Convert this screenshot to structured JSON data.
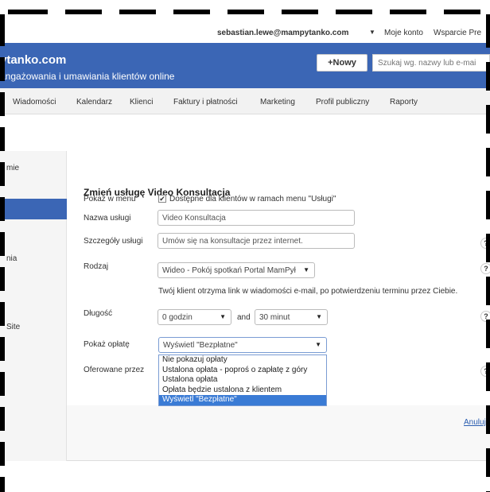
{
  "userbar": {
    "email": "sebastian.lewe@mampytanko.com",
    "account": "Moje konto",
    "help": "Wsparcie Pre"
  },
  "header": {
    "brand": "ytanko.com",
    "tagline": "angażowania i umawiania klientów online",
    "new_button": "+Nowy",
    "search_placeholder": "Szukaj wg. nazwy lub e-mai"
  },
  "nav": {
    "items": [
      "Wiadomości",
      "Kalendarz",
      "Klienci",
      "Faktury i płatności",
      "Marketing",
      "Profil publiczny",
      "Raporty"
    ]
  },
  "sidebar": {
    "items": [
      "mie",
      "nia",
      "Site"
    ]
  },
  "form": {
    "title": "Zmień usługę Video Konsultacja",
    "show_in_menu_label": "Pokaż w menu",
    "show_in_menu_check": "✔",
    "show_in_menu_text": "Dostępne dla klientów w ramach menu \"Usługi\"",
    "name_label": "Nazwa usługi",
    "name_value": "Video Konsultacja",
    "details_label": "Szczegóły usługi",
    "details_value": "Umów się na konsultacje przez internet.",
    "type_label": "Rodzaj",
    "type_value": "Wideo - Pokój spotkań Portal MamPył",
    "type_info": "Twój klient otrzyma link w wiadomości e-mail, po potwierdzeniu terminu przez Ciebie.",
    "duration_label": "Długość",
    "hours_value": "0 godzin",
    "and_text": "and",
    "minutes_value": "30 minut",
    "fee_label": "Pokaż opłatę",
    "fee_value": "Wyświetl \"Bezpłatne\"",
    "offered_label": "Oferowane przez",
    "fee_options": [
      "Nie pokazuj opłaty",
      "Ustalona opłata - poproś o zapłatę z góry",
      "Ustalona opłata",
      "Opłata będzie ustalona z klientem",
      "Wyświetl \"Bezpłatne\""
    ],
    "help_icon_text": "?",
    "cancel": "Anuluj"
  },
  "icons": {
    "caret": "▼",
    "select_arrow": "▼"
  }
}
